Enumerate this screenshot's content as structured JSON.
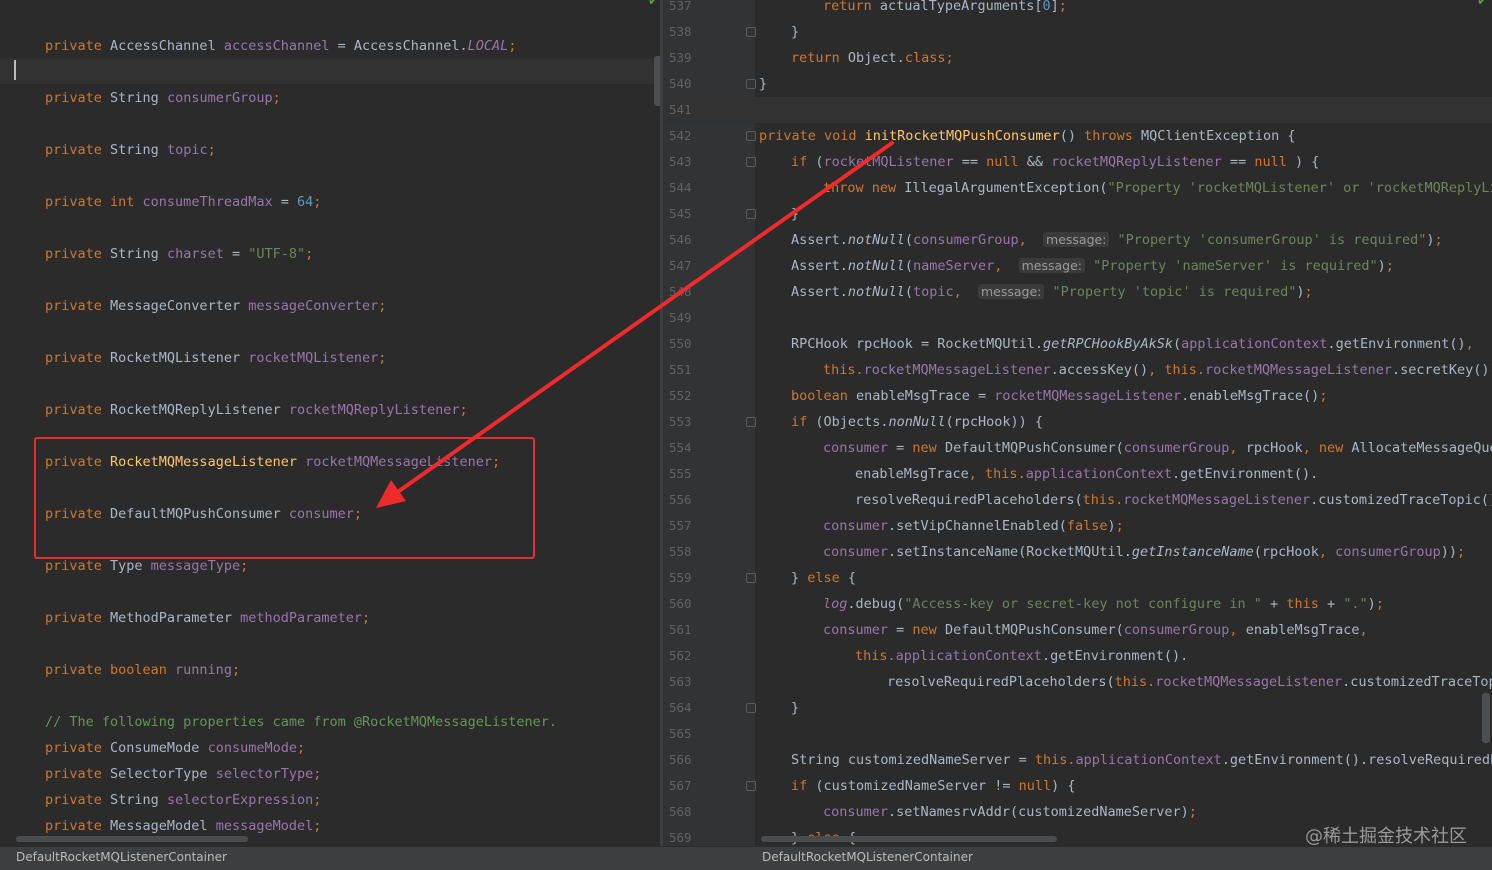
{
  "editor": {
    "left_file_tab": "DefaultRocketMQListenerContainer",
    "right_file_tab": "DefaultRocketMQListenerContainer",
    "watermark": "@稀土掘金技术社区",
    "colors": {
      "background": "#2b2b2b",
      "keyword": "#cc7832",
      "field": "#9876aa",
      "string": "#6a8759",
      "number": "#6897bb",
      "comment": "#629755",
      "method_decl": "#ffc66d",
      "annotation_red": "#ee2a2a"
    }
  },
  "left_lines": [
    [
      [
        "kw",
        "private "
      ],
      [
        "",
        "AccessChannel "
      ],
      [
        "fld",
        "accessChannel"
      ],
      [
        "",
        " = AccessChannel."
      ],
      [
        "fld it",
        "LOCAL"
      ],
      [
        "kw",
        ";"
      ]
    ],
    [
      [
        "kw",
        "private "
      ],
      [
        "",
        "String "
      ],
      [
        "fld",
        "consumerGroup"
      ],
      [
        "kw",
        ";"
      ]
    ],
    [
      [
        "kw",
        "private "
      ],
      [
        "",
        "String "
      ],
      [
        "fld",
        "topic"
      ],
      [
        "kw",
        ";"
      ]
    ],
    [
      [
        "kw",
        "private int "
      ],
      [
        "fld",
        "consumeThreadMax"
      ],
      [
        "",
        " = "
      ],
      [
        "num",
        "64"
      ],
      [
        "kw",
        ";"
      ]
    ],
    [
      [
        "kw",
        "private "
      ],
      [
        "",
        "String "
      ],
      [
        "fld",
        "charset"
      ],
      [
        "",
        " = "
      ],
      [
        "str",
        "\"UTF-8\""
      ],
      [
        "kw",
        ";"
      ]
    ],
    [
      [
        "kw",
        "private "
      ],
      [
        "",
        "MessageConverter "
      ],
      [
        "fld",
        "messageConverter"
      ],
      [
        "kw",
        ";"
      ]
    ],
    [
      [
        "kw",
        "private "
      ],
      [
        "",
        "RocketMQListener "
      ],
      [
        "fld",
        "rocketMQListener"
      ],
      [
        "kw",
        ";"
      ]
    ],
    [
      [
        "kw",
        "private "
      ],
      [
        "",
        "RocketMQReplyListener "
      ],
      [
        "fld",
        "rocketMQReplyListener"
      ],
      [
        "kw",
        ";"
      ]
    ],
    [
      [
        "kw",
        "private "
      ],
      [
        "fn",
        "RocketMQMessageListener "
      ],
      [
        "fld",
        "rocketMQMessageListener"
      ],
      [
        "kw",
        ";"
      ]
    ],
    [
      [
        "kw",
        "private "
      ],
      [
        "",
        "DefaultMQPushConsumer "
      ],
      [
        "fld",
        "consumer"
      ],
      [
        "kw",
        ";"
      ]
    ],
    [
      [
        "kw",
        "private "
      ],
      [
        "",
        "Type "
      ],
      [
        "fld",
        "messageType"
      ],
      [
        "kw",
        ";"
      ]
    ],
    [
      [
        "kw",
        "private "
      ],
      [
        "",
        "MethodParameter "
      ],
      [
        "fld",
        "methodParameter"
      ],
      [
        "kw",
        ";"
      ]
    ],
    [
      [
        "kw",
        "private boolean "
      ],
      [
        "fld",
        "running"
      ],
      [
        "kw",
        ";"
      ]
    ],
    [
      [
        "cmt",
        "// The following properties came from @RocketMQMessageListener."
      ]
    ],
    [
      [
        "kw",
        "private "
      ],
      [
        "",
        "ConsumeMode "
      ],
      [
        "fld",
        "consumeMode"
      ],
      [
        "kw",
        ";"
      ]
    ],
    [
      [
        "kw",
        "private "
      ],
      [
        "",
        "SelectorType "
      ],
      [
        "fld",
        "selectorType"
      ],
      [
        "kw",
        ";"
      ]
    ],
    [
      [
        "kw",
        "private "
      ],
      [
        "",
        "String "
      ],
      [
        "fld",
        "selectorExpression"
      ],
      [
        "kw",
        ";"
      ]
    ],
    [
      [
        "kw",
        "private "
      ],
      [
        "",
        "MessageModel "
      ],
      [
        "fld",
        "messageModel"
      ],
      [
        "kw",
        ";"
      ]
    ]
  ],
  "right_line_numbers": [
    "537",
    "538",
    "539",
    "540",
    "541",
    "542",
    "543",
    "544",
    "545",
    "546",
    "547",
    "548",
    "549",
    "550",
    "551",
    "552",
    "553",
    "554",
    "555",
    "556",
    "557",
    "558",
    "559",
    "560",
    "561",
    "562",
    "563",
    "564",
    "565",
    "566",
    "567",
    "568",
    "569"
  ],
  "right_lines": [
    [
      [
        "kw",
        "return "
      ],
      [
        "",
        "actualTypeArguments["
      ],
      [
        "num",
        "0"
      ],
      [
        "",
        "]"
      ],
      [
        "kw",
        ";"
      ]
    ],
    [
      [
        "",
        "}"
      ]
    ],
    [
      [
        "kw",
        "return "
      ],
      [
        "",
        "Object."
      ],
      [
        "kw",
        "class;"
      ]
    ],
    [
      [
        "",
        "}"
      ]
    ],
    [],
    [
      [
        "kw",
        "private void "
      ],
      [
        "fn",
        "initRocketMQPushConsumer"
      ],
      [
        "",
        "() "
      ],
      [
        "kw",
        "throws "
      ],
      [
        "",
        "MQClientException {"
      ]
    ],
    [
      [
        "kw",
        "if "
      ],
      [
        "",
        "("
      ],
      [
        "fld",
        "rocketMQListener"
      ],
      [
        "",
        " == "
      ],
      [
        "kw",
        "null "
      ],
      [
        "",
        "&& "
      ],
      [
        "fld",
        "rocketMQReplyListener"
      ],
      [
        "",
        " == "
      ],
      [
        "kw",
        "null"
      ],
      [
        "",
        " ) {"
      ]
    ],
    [
      [
        "kw",
        "throw new "
      ],
      [
        "",
        "IllegalArgumentException("
      ],
      [
        "str",
        "\"Property 'rocketMQListener' or 'rocketMQReplyListener' is required\""
      ],
      [
        "",
        ")"
      ],
      [
        "kw",
        ";"
      ]
    ],
    [
      [
        "",
        "}"
      ]
    ],
    [
      [
        "",
        "Assert."
      ],
      [
        "it",
        "notNull"
      ],
      [
        "",
        "("
      ],
      [
        "fld",
        "consumerGroup"
      ],
      [
        "kw",
        ",  "
      ],
      [
        "hint",
        "message:"
      ],
      [
        "str",
        " \"Property 'consumerGroup' is required\""
      ],
      [
        "",
        ")"
      ],
      [
        "kw",
        ";"
      ]
    ],
    [
      [
        "",
        "Assert."
      ],
      [
        "it",
        "notNull"
      ],
      [
        "",
        "("
      ],
      [
        "fld",
        "nameServer"
      ],
      [
        "kw",
        ",  "
      ],
      [
        "hint",
        "message:"
      ],
      [
        "str",
        " \"Property 'nameServer' is required\""
      ],
      [
        "",
        ")"
      ],
      [
        "kw",
        ";"
      ]
    ],
    [
      [
        "",
        "Assert."
      ],
      [
        "it",
        "notNull"
      ],
      [
        "",
        "("
      ],
      [
        "fld",
        "topic"
      ],
      [
        "kw",
        ",  "
      ],
      [
        "hint",
        "message:"
      ],
      [
        "str",
        " \"Property 'topic' is required\""
      ],
      [
        "",
        ")"
      ],
      [
        "kw",
        ";"
      ]
    ],
    [],
    [
      [
        "",
        "RPCHook rpcHook = RocketMQUtil."
      ],
      [
        "it",
        "getRPCHookByAkSk"
      ],
      [
        "",
        "("
      ],
      [
        "fld",
        "applicationContext"
      ],
      [
        "",
        ".getEnvironment()"
      ],
      [
        "kw",
        ","
      ]
    ],
    [
      [
        "kw",
        "this."
      ],
      [
        "fld",
        "rocketMQMessageListener"
      ],
      [
        "",
        ".accessKey()"
      ],
      [
        "kw",
        ", this."
      ],
      [
        "fld",
        "rocketMQMessageListener"
      ],
      [
        "",
        ".secretKey())"
      ],
      [
        "kw",
        ";"
      ]
    ],
    [
      [
        "kw",
        "boolean "
      ],
      [
        "",
        "enableMsgTrace = "
      ],
      [
        "fld",
        "rocketMQMessageListener"
      ],
      [
        "",
        ".enableMsgTrace()"
      ],
      [
        "kw",
        ";"
      ]
    ],
    [
      [
        "kw",
        "if "
      ],
      [
        "",
        "(Objects."
      ],
      [
        "it",
        "nonNull"
      ],
      [
        "",
        "(rpcHook)) {"
      ]
    ],
    [
      [
        "fld",
        "consumer"
      ],
      [
        "",
        " = "
      ],
      [
        "kw",
        "new "
      ],
      [
        "",
        "DefaultMQPushConsumer("
      ],
      [
        "fld",
        "consumerGroup"
      ],
      [
        "kw",
        ", "
      ],
      [
        "",
        "rpcHook"
      ],
      [
        "kw",
        ", new "
      ],
      [
        "",
        "AllocateMessageQueueAveragely()"
      ],
      [
        "kw",
        ","
      ]
    ],
    [
      [
        "",
        "enableMsgTrace"
      ],
      [
        "kw",
        ", this."
      ],
      [
        "fld",
        "applicationContext"
      ],
      [
        "",
        ".getEnvironment()."
      ]
    ],
    [
      [
        "",
        "resolveRequiredPlaceholders("
      ],
      [
        "kw",
        "this."
      ],
      [
        "fld",
        "rocketMQMessageListener"
      ],
      [
        "",
        ".customizedTraceTopic()))"
      ],
      [
        "kw",
        ";"
      ]
    ],
    [
      [
        "fld",
        "consumer"
      ],
      [
        "",
        ".setVipChannelEnabled("
      ],
      [
        "kw",
        "false"
      ],
      [
        "",
        ")"
      ],
      [
        "kw",
        ";"
      ]
    ],
    [
      [
        "fld",
        "consumer"
      ],
      [
        "",
        ".setInstanceName(RocketMQUtil."
      ],
      [
        "it",
        "getInstanceName"
      ],
      [
        "",
        "(rpcHook"
      ],
      [
        "kw",
        ", "
      ],
      [
        "fld",
        "consumerGroup"
      ],
      [
        "",
        "))"
      ],
      [
        "kw",
        ";"
      ]
    ],
    [
      [
        "",
        "} "
      ],
      [
        "kw",
        "else "
      ],
      [
        "",
        "{"
      ]
    ],
    [
      [
        "fld it",
        "log"
      ],
      [
        "",
        ".debug("
      ],
      [
        "str",
        "\"Access-key or secret-key not configure in \""
      ],
      [
        "",
        " + "
      ],
      [
        "kw",
        "this"
      ],
      [
        "",
        " + "
      ],
      [
        "str",
        "\".\""
      ],
      [
        "",
        ")"
      ],
      [
        "kw",
        ";"
      ]
    ],
    [
      [
        "fld",
        "consumer"
      ],
      [
        "",
        " = "
      ],
      [
        "kw",
        "new "
      ],
      [
        "",
        "DefaultMQPushConsumer("
      ],
      [
        "fld",
        "consumerGroup"
      ],
      [
        "kw",
        ", "
      ],
      [
        "",
        "enableMsgTrace"
      ],
      [
        "kw",
        ","
      ]
    ],
    [
      [
        "kw",
        "this."
      ],
      [
        "fld",
        "applicationContext"
      ],
      [
        "",
        ".getEnvironment()."
      ]
    ],
    [
      [
        "",
        "resolveRequiredPlaceholders("
      ],
      [
        "kw",
        "this."
      ],
      [
        "fld",
        "rocketMQMessageListener"
      ],
      [
        "",
        ".customizedTraceTopic()))"
      ],
      [
        "kw",
        ";"
      ]
    ],
    [
      [
        "",
        "}"
      ]
    ],
    [],
    [
      [
        "",
        "String customizedNameServer = "
      ],
      [
        "kw",
        "this."
      ],
      [
        "fld",
        "applicationContext"
      ],
      [
        "",
        ".getEnvironment().resolveRequiredPlaceholders("
      ]
    ],
    [
      [
        "kw",
        "if "
      ],
      [
        "",
        "(customizedNameServer != "
      ],
      [
        "kw",
        "null"
      ],
      [
        "",
        ") {"
      ]
    ],
    [
      [
        "fld",
        "consumer"
      ],
      [
        "",
        ".setNamesrvAddr(customizedNameServer)"
      ],
      [
        "kw",
        ";"
      ]
    ],
    [
      [
        "",
        "} "
      ],
      [
        "kw",
        "else "
      ],
      [
        "",
        "{"
      ]
    ]
  ]
}
